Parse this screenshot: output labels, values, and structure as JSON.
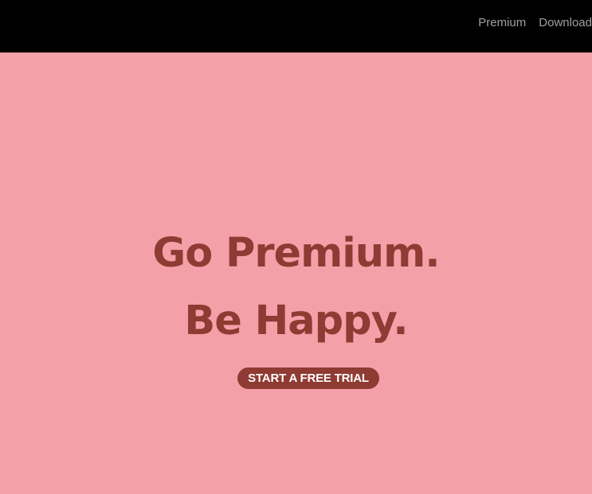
{
  "nav": {
    "links": [
      {
        "label": "Premium"
      },
      {
        "label": "Download"
      }
    ]
  },
  "hero": {
    "headline_line1": "Go Premium.",
    "headline_line2": "Be Happy.",
    "cta_label": "START A FREE TRIAL"
  },
  "colors": {
    "navbar_bg": "#000000",
    "nav_link_text": "#a0a0a0",
    "hero_bg": "#f3a0a9",
    "accent": "#8f3a32",
    "cta_text": "#ffffff"
  }
}
